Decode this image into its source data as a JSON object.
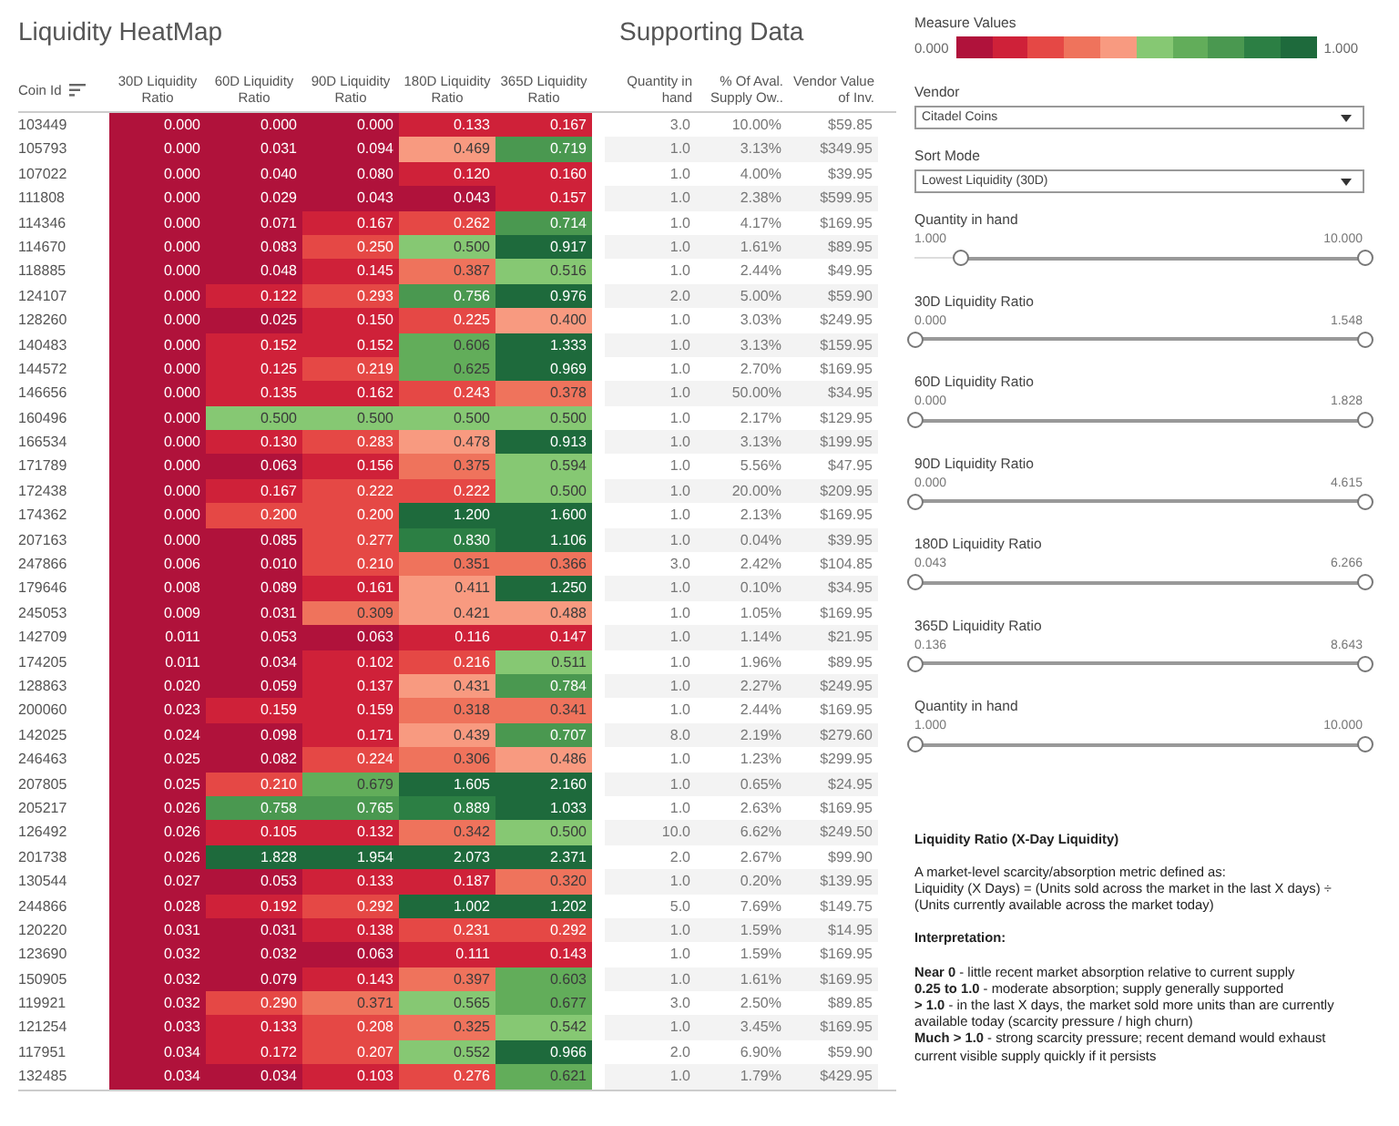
{
  "heatmap": {
    "title": "Liquidity HeatMap",
    "coin_header": "Coin Id",
    "columns": [
      "30D Liquidity Ratio",
      "60D Liquidity Ratio",
      "90D Liquidity Ratio",
      "180D Liquidity Ratio",
      "365D Liquidity Ratio"
    ]
  },
  "supporting": {
    "title": "Supporting Data",
    "columns": [
      "Quantity in hand",
      "% Of Aval. Supply Ow..",
      "Vendor Value of Inv."
    ]
  },
  "rows": [
    {
      "coin_id": "103449",
      "ratios": [
        "0.000",
        "0.000",
        "0.000",
        "0.133",
        "0.167"
      ],
      "quantity": "3.0",
      "share": "10.00%",
      "value": "$59.85"
    },
    {
      "coin_id": "105793",
      "ratios": [
        "0.000",
        "0.031",
        "0.094",
        "0.469",
        "0.719"
      ],
      "quantity": "1.0",
      "share": "3.13%",
      "value": "$349.95"
    },
    {
      "coin_id": "107022",
      "ratios": [
        "0.000",
        "0.040",
        "0.080",
        "0.120",
        "0.160"
      ],
      "quantity": "1.0",
      "share": "4.00%",
      "value": "$39.95"
    },
    {
      "coin_id": "111808",
      "ratios": [
        "0.000",
        "0.029",
        "0.043",
        "0.043",
        "0.157"
      ],
      "quantity": "1.0",
      "share": "2.38%",
      "value": "$599.95"
    },
    {
      "coin_id": "114346",
      "ratios": [
        "0.000",
        "0.071",
        "0.167",
        "0.262",
        "0.714"
      ],
      "quantity": "1.0",
      "share": "4.17%",
      "value": "$169.95"
    },
    {
      "coin_id": "114670",
      "ratios": [
        "0.000",
        "0.083",
        "0.250",
        "0.500",
        "0.917"
      ],
      "quantity": "1.0",
      "share": "1.61%",
      "value": "$89.95"
    },
    {
      "coin_id": "118885",
      "ratios": [
        "0.000",
        "0.048",
        "0.145",
        "0.387",
        "0.516"
      ],
      "quantity": "1.0",
      "share": "2.44%",
      "value": "$49.95"
    },
    {
      "coin_id": "124107",
      "ratios": [
        "0.000",
        "0.122",
        "0.293",
        "0.756",
        "0.976"
      ],
      "quantity": "2.0",
      "share": "5.00%",
      "value": "$59.90"
    },
    {
      "coin_id": "128260",
      "ratios": [
        "0.000",
        "0.025",
        "0.150",
        "0.225",
        "0.400"
      ],
      "quantity": "1.0",
      "share": "3.03%",
      "value": "$249.95"
    },
    {
      "coin_id": "140483",
      "ratios": [
        "0.000",
        "0.152",
        "0.152",
        "0.606",
        "1.333"
      ],
      "quantity": "1.0",
      "share": "3.13%",
      "value": "$159.95"
    },
    {
      "coin_id": "144572",
      "ratios": [
        "0.000",
        "0.125",
        "0.219",
        "0.625",
        "0.969"
      ],
      "quantity": "1.0",
      "share": "2.70%",
      "value": "$169.95"
    },
    {
      "coin_id": "146656",
      "ratios": [
        "0.000",
        "0.135",
        "0.162",
        "0.243",
        "0.378"
      ],
      "quantity": "1.0",
      "share": "50.00%",
      "value": "$34.95"
    },
    {
      "coin_id": "160496",
      "ratios": [
        "0.000",
        "0.500",
        "0.500",
        "0.500",
        "0.500"
      ],
      "quantity": "1.0",
      "share": "2.17%",
      "value": "$129.95"
    },
    {
      "coin_id": "166534",
      "ratios": [
        "0.000",
        "0.130",
        "0.283",
        "0.478",
        "0.913"
      ],
      "quantity": "1.0",
      "share": "3.13%",
      "value": "$199.95"
    },
    {
      "coin_id": "171789",
      "ratios": [
        "0.000",
        "0.063",
        "0.156",
        "0.375",
        "0.594"
      ],
      "quantity": "1.0",
      "share": "5.56%",
      "value": "$47.95"
    },
    {
      "coin_id": "172438",
      "ratios": [
        "0.000",
        "0.167",
        "0.222",
        "0.222",
        "0.500"
      ],
      "quantity": "1.0",
      "share": "20.00%",
      "value": "$209.95"
    },
    {
      "coin_id": "174362",
      "ratios": [
        "0.000",
        "0.200",
        "0.200",
        "1.200",
        "1.600"
      ],
      "quantity": "1.0",
      "share": "2.13%",
      "value": "$169.95"
    },
    {
      "coin_id": "207163",
      "ratios": [
        "0.000",
        "0.085",
        "0.277",
        "0.830",
        "1.106"
      ],
      "quantity": "1.0",
      "share": "0.04%",
      "value": "$39.95"
    },
    {
      "coin_id": "247866",
      "ratios": [
        "0.006",
        "0.010",
        "0.210",
        "0.351",
        "0.366"
      ],
      "quantity": "3.0",
      "share": "2.42%",
      "value": "$104.85"
    },
    {
      "coin_id": "179646",
      "ratios": [
        "0.008",
        "0.089",
        "0.161",
        "0.411",
        "1.250"
      ],
      "quantity": "1.0",
      "share": "0.10%",
      "value": "$34.95"
    },
    {
      "coin_id": "245053",
      "ratios": [
        "0.009",
        "0.031",
        "0.309",
        "0.421",
        "0.488"
      ],
      "quantity": "1.0",
      "share": "1.05%",
      "value": "$169.95"
    },
    {
      "coin_id": "142709",
      "ratios": [
        "0.011",
        "0.053",
        "0.063",
        "0.116",
        "0.147"
      ],
      "quantity": "1.0",
      "share": "1.14%",
      "value": "$21.95"
    },
    {
      "coin_id": "174205",
      "ratios": [
        "0.011",
        "0.034",
        "0.102",
        "0.216",
        "0.511"
      ],
      "quantity": "1.0",
      "share": "1.96%",
      "value": "$89.95"
    },
    {
      "coin_id": "128863",
      "ratios": [
        "0.020",
        "0.059",
        "0.137",
        "0.431",
        "0.784"
      ],
      "quantity": "1.0",
      "share": "2.27%",
      "value": "$249.95"
    },
    {
      "coin_id": "200060",
      "ratios": [
        "0.023",
        "0.159",
        "0.159",
        "0.318",
        "0.341"
      ],
      "quantity": "1.0",
      "share": "2.44%",
      "value": "$169.95"
    },
    {
      "coin_id": "142025",
      "ratios": [
        "0.024",
        "0.098",
        "0.171",
        "0.439",
        "0.707"
      ],
      "quantity": "8.0",
      "share": "2.19%",
      "value": "$279.60"
    },
    {
      "coin_id": "246463",
      "ratios": [
        "0.025",
        "0.082",
        "0.224",
        "0.306",
        "0.486"
      ],
      "quantity": "1.0",
      "share": "1.23%",
      "value": "$299.95"
    },
    {
      "coin_id": "207805",
      "ratios": [
        "0.025",
        "0.210",
        "0.679",
        "1.605",
        "2.160"
      ],
      "quantity": "1.0",
      "share": "0.65%",
      "value": "$24.95"
    },
    {
      "coin_id": "205217",
      "ratios": [
        "0.026",
        "0.758",
        "0.765",
        "0.889",
        "1.033"
      ],
      "quantity": "1.0",
      "share": "2.63%",
      "value": "$169.95"
    },
    {
      "coin_id": "126492",
      "ratios": [
        "0.026",
        "0.105",
        "0.132",
        "0.342",
        "0.500"
      ],
      "quantity": "10.0",
      "share": "6.62%",
      "value": "$249.50"
    },
    {
      "coin_id": "201738",
      "ratios": [
        "0.026",
        "1.828",
        "1.954",
        "2.073",
        "2.371"
      ],
      "quantity": "2.0",
      "share": "2.67%",
      "value": "$99.90"
    },
    {
      "coin_id": "130544",
      "ratios": [
        "0.027",
        "0.053",
        "0.133",
        "0.187",
        "0.320"
      ],
      "quantity": "1.0",
      "share": "0.20%",
      "value": "$139.95"
    },
    {
      "coin_id": "244866",
      "ratios": [
        "0.028",
        "0.192",
        "0.292",
        "1.002",
        "1.202"
      ],
      "quantity": "5.0",
      "share": "7.69%",
      "value": "$149.75"
    },
    {
      "coin_id": "120220",
      "ratios": [
        "0.031",
        "0.031",
        "0.138",
        "0.231",
        "0.292"
      ],
      "quantity": "1.0",
      "share": "1.59%",
      "value": "$14.95"
    },
    {
      "coin_id": "123690",
      "ratios": [
        "0.032",
        "0.032",
        "0.063",
        "0.111",
        "0.143"
      ],
      "quantity": "1.0",
      "share": "1.59%",
      "value": "$169.95"
    },
    {
      "coin_id": "150905",
      "ratios": [
        "0.032",
        "0.079",
        "0.143",
        "0.397",
        "0.603"
      ],
      "quantity": "1.0",
      "share": "1.61%",
      "value": "$169.95"
    },
    {
      "coin_id": "119921",
      "ratios": [
        "0.032",
        "0.290",
        "0.371",
        "0.565",
        "0.677"
      ],
      "quantity": "3.0",
      "share": "2.50%",
      "value": "$89.85"
    },
    {
      "coin_id": "121254",
      "ratios": [
        "0.033",
        "0.133",
        "0.208",
        "0.325",
        "0.542"
      ],
      "quantity": "1.0",
      "share": "3.45%",
      "value": "$169.95"
    },
    {
      "coin_id": "117951",
      "ratios": [
        "0.034",
        "0.172",
        "0.207",
        "0.552",
        "0.966"
      ],
      "quantity": "2.0",
      "share": "6.90%",
      "value": "$59.90"
    },
    {
      "coin_id": "132485",
      "ratios": [
        "0.034",
        "0.034",
        "0.103",
        "0.276",
        "0.621"
      ],
      "quantity": "1.0",
      "share": "1.79%",
      "value": "$429.95"
    }
  ],
  "legend": {
    "title": "Measure Values",
    "min": "0.000",
    "max": "1.000"
  },
  "dropdowns": [
    {
      "label": "Vendor",
      "value": "Citadel Coins"
    },
    {
      "label": "Sort Mode",
      "value": "Lowest Liquidity (30D)"
    }
  ],
  "sliders": [
    {
      "label": "Quantity in hand",
      "min": "1.000",
      "max": "10.000",
      "level": 0.9
    },
    {
      "label": "30D Liquidity Ratio",
      "min": "0.000",
      "max": "1.548",
      "level": 1
    },
    {
      "label": "60D Liquidity Ratio",
      "min": "0.000",
      "max": "1.828",
      "level": 1
    },
    {
      "label": "90D Liquidity Ratio",
      "min": "0.000",
      "max": "4.615",
      "level": 1
    },
    {
      "label": "180D Liquidity Ratio",
      "min": "0.043",
      "max": "6.266",
      "level": 1
    },
    {
      "label": "365D Liquidity Ratio",
      "min": "0.136",
      "max": "8.643",
      "level": 1
    },
    {
      "label": "Quantity in hand",
      "min": "1.000",
      "max": "10.000",
      "level": 1
    }
  ],
  "notes": {
    "title": "Liquidity Ratio (X-Day Liquidity)",
    "intro": "A market-level scarcity/absorption metric defined as:",
    "formula": "Liquidity (X Days) = (Units sold across the market in the last X days) ÷ (Units currently available across the market today)",
    "subtitle": "Interpretation:",
    "items": [
      "**Near 0** - little recent market absorption relative to current supply",
      "**0.25 to 1.0** - moderate absorption; supply generally supported",
      "**> 1.0** - in the last X days, the market sold more units than are currently available today (scarcity pressure / high churn)",
      "**Much > 1.0** - strong scarcity pressure; recent demand would exhaust current visible supply quickly if it persists"
    ]
  }
}
